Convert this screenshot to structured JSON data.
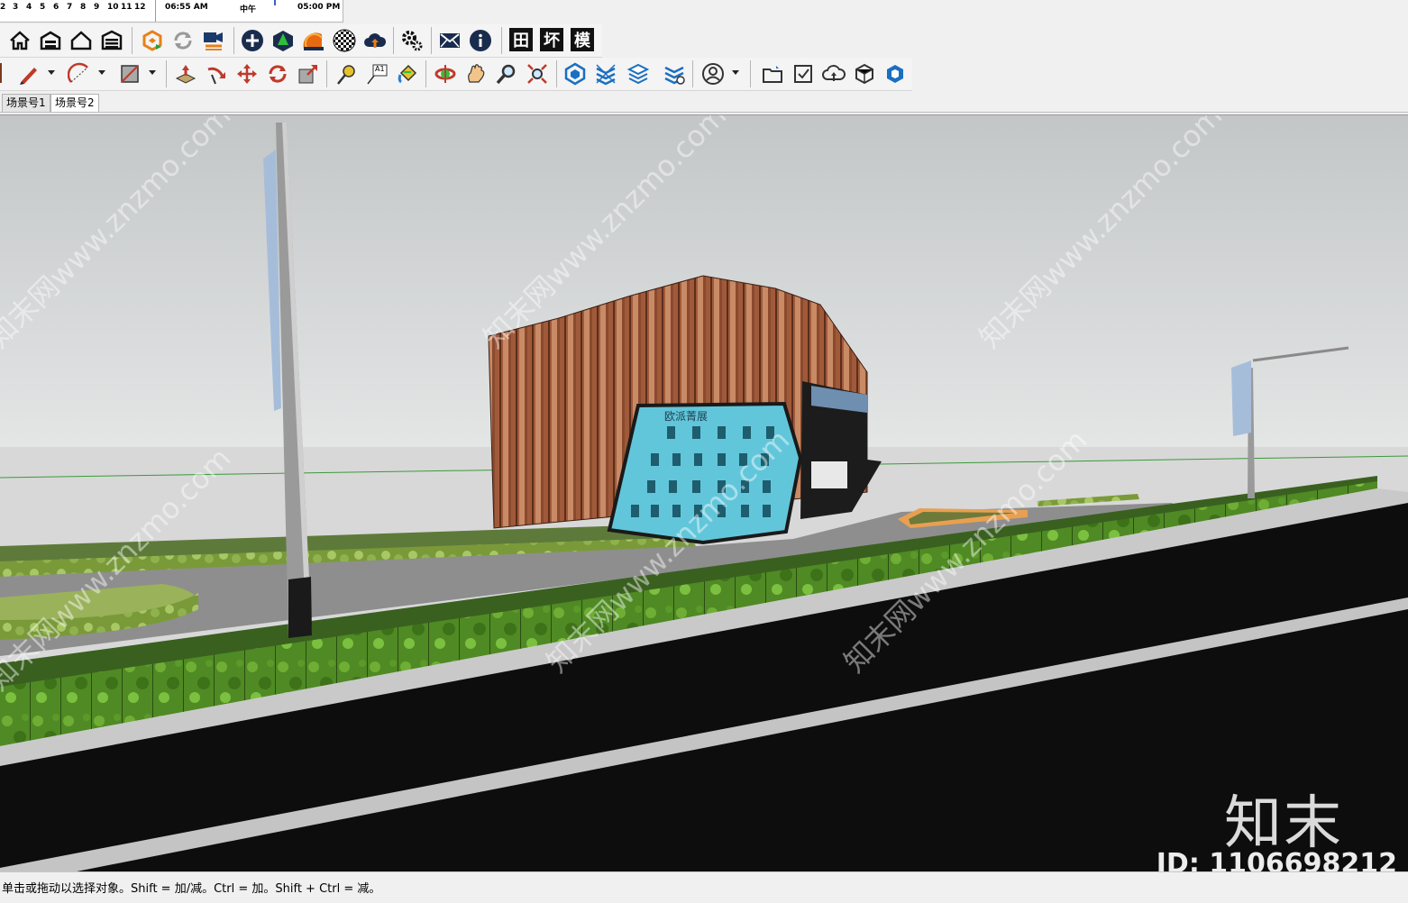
{
  "shadow_settings": {
    "months": [
      "2",
      "3",
      "4",
      "5",
      "6",
      "7",
      "8",
      "9",
      "10",
      "11",
      "12"
    ],
    "time_start": "06:55 AM",
    "time_noon": "中午",
    "time_end": "05:00 PM"
  },
  "toolbar_row1": {
    "icons": [
      "home-icon",
      "warehouse-icon",
      "house-outline-icon",
      "garage-icon",
      "extension-warehouse-icon",
      "sync-icon",
      "send-to-layout-icon",
      "add-location-icon",
      "terrain-icon",
      "sandbox-icon",
      "checker-icon",
      "cloud-upload-icon",
      "settings-gears-icon",
      "mail-icon",
      "info-icon"
    ],
    "text_buttons": [
      "田",
      "坏",
      "模"
    ]
  },
  "toolbar_row2": {
    "icons": [
      "pencil-icon",
      "arc-icon",
      "rectangle-icon",
      "push-pull-icon",
      "follow-me-icon",
      "move-icon",
      "rotate-icon",
      "scale-icon",
      "tape-measure-icon",
      "text-label-icon",
      "paint-bucket-icon",
      "orbit-icon",
      "pan-icon",
      "zoom-icon",
      "zoom-extents-icon",
      "component-icon",
      "layers-icon",
      "outliner-icon",
      "styles-icon",
      "account-icon",
      "open-folder-icon",
      "checkbox-icon",
      "cloud-sync-icon",
      "model-info-icon",
      "logo-icon"
    ],
    "text_label_sample": "A1"
  },
  "scene_tabs": [
    {
      "label": "场景号1",
      "active": false
    },
    {
      "label": "场景号2",
      "active": true
    }
  ],
  "viewport": {
    "sky_top": "#c3c6c7",
    "sky_bottom": "#e4e6e6",
    "ground": "#d8d8d8",
    "road": "#0d0d0d",
    "hedge": "#4f8a24",
    "building_wood": "#a05a3a",
    "glass": "#62c6da",
    "building_sign": "欧派菁展",
    "watermark_text": "知末网www.znzmo.com"
  },
  "watermark": {
    "logo": "知末",
    "id_text": "ID: 1106698212"
  },
  "status_text": "单击或拖动以选择对象。Shift = 加/减。Ctrl = 加。Shift + Ctrl = 减。"
}
